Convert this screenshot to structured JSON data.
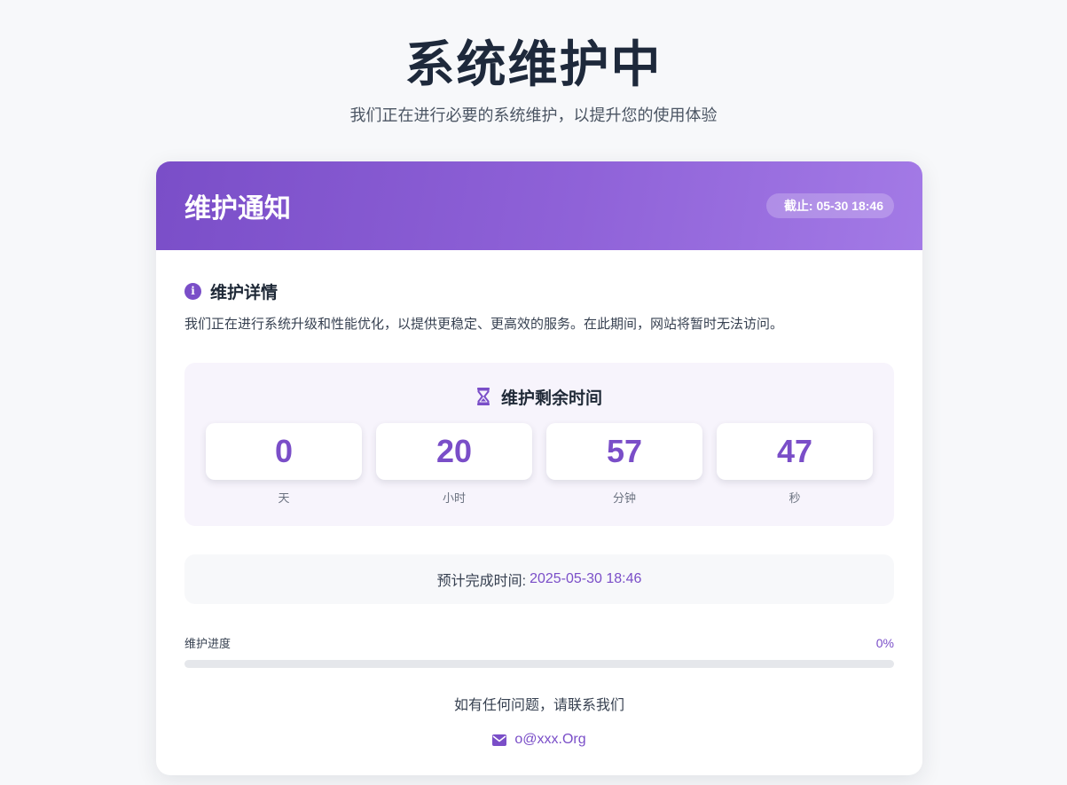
{
  "page": {
    "title": "系统维护中",
    "subtitle": "我们正在进行必要的系统维护，以提升您的使用体验"
  },
  "card": {
    "title": "维护通知",
    "deadline_badge": "截止: 05-30 18:46",
    "details_heading": "维护详情",
    "details_text": "我们正在进行系统升级和性能优化，以提供更稳定、更高效的服务。在此期间，网站将暂时无法访问。",
    "countdown": {
      "heading": "维护剩余时间",
      "units": [
        {
          "value": "0",
          "label": "天"
        },
        {
          "value": "20",
          "label": "小时"
        },
        {
          "value": "57",
          "label": "分钟"
        },
        {
          "value": "47",
          "label": "秒"
        }
      ]
    },
    "eta": {
      "label": "预计完成时间:",
      "value": "2025-05-30 18:46"
    },
    "progress": {
      "label": "维护进度",
      "percent_text": "0%",
      "percent": 0
    },
    "contact": {
      "text": "如有任何问题，请联系我们",
      "email": "o@xxx.Org"
    }
  },
  "icons": {
    "info": "info-icon",
    "hourglass": "hourglass-icon",
    "mail": "mail-icon"
  },
  "colors": {
    "accent": "#7a4ec8",
    "background": "#f7f8fa",
    "header_gradient_start": "#7a4ec8",
    "header_gradient_end": "#a37ae6"
  }
}
